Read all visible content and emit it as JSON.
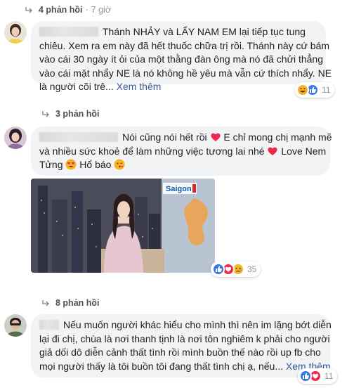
{
  "threads": [
    {
      "replies": "4 phản hồi",
      "time": "7 giờ"
    },
    {
      "replies": "3 phản hồi"
    },
    {
      "replies": "8 phản hồi"
    }
  ],
  "comments": [
    {
      "line1": "Thánh NHẢY và LẨY NAM EM lại tiếp tục tung",
      "line2": "chiêu. Xem ra em này đã hết thuốc chữa trị rồi. Thánh này cứ bám",
      "line3": "vào cái 30 ngày ít ỏi của một thằng đàn ông mà nó đã chửi thẳng",
      "line4": "vào cái mặt nhẩy NE là nó không hề yêu mà vẫn cứ thích nhẩy. NE",
      "line5": "là người cõi trê...",
      "see_more": "Xem thêm",
      "reaction_count": "11"
    },
    {
      "line1": "Nói cũng nói hết rồi",
      "line1b": "E chỉ mong chị mạnh mẽ",
      "line2": "và nhiều sức khoẻ để làm những việc tương lai nhé",
      "line2b": "Love Nem",
      "line3": "Tửng",
      "line3b": "Hổ báo",
      "photo_logo": "Saigon",
      "reaction_count": "35"
    },
    {
      "line1": "Nếu muốn người khác hiểu cho mình thì nên im lặng bớt diễn",
      "line2": "lại đi chị, chùa là nơi thanh tịnh là nơi tôn nghiêm k phải cho người",
      "line3": "giả dối dô diễn cảnh thất tình rồi mình buồn thế nào rồi up fb cho",
      "line4": "mọi người thấy là tôi buồn tôi đang thất tình chị ạ, nếu...",
      "see_more": "Xem thêm",
      "reaction_count": "11"
    }
  ],
  "colors": {
    "link": "#385898",
    "bubble": "#f2f3f5",
    "meta": "#90949c",
    "like": "#3578e5",
    "love": "#f0284a",
    "haha": "#f7b125"
  }
}
